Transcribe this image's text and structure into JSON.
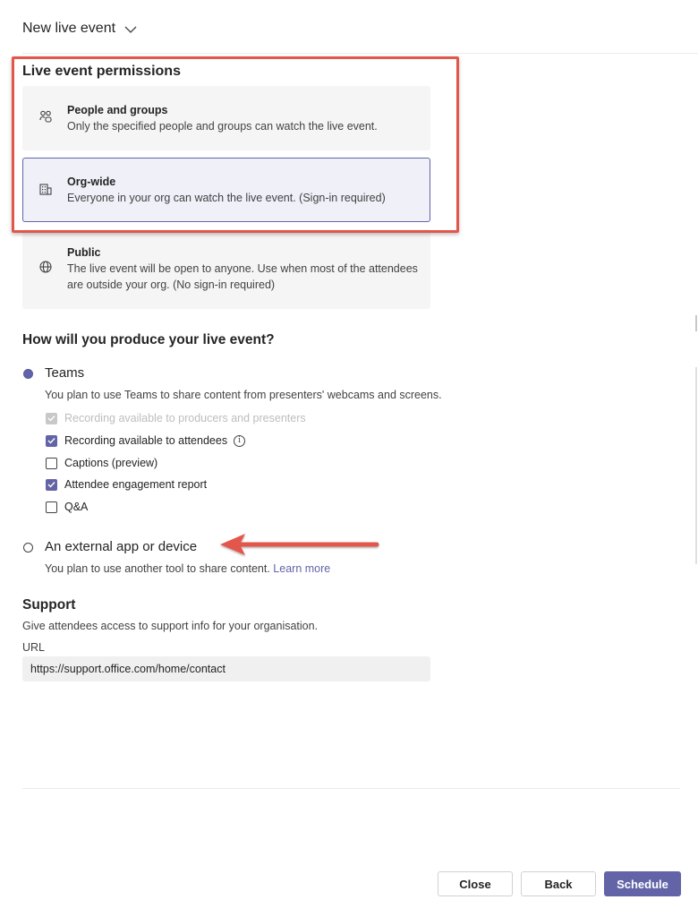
{
  "header": {
    "title": "New live event"
  },
  "permissions": {
    "title": "Live event permissions",
    "options": [
      {
        "title": "People and groups",
        "desc": "Only the specified people and groups can watch the live event.",
        "icon": "people-icon"
      },
      {
        "title": "Org-wide",
        "desc": "Everyone in your org can watch the live event. (Sign-in required)",
        "icon": "building-icon",
        "selected": true
      },
      {
        "title": "Public",
        "desc_line1": "The live event will be open to anyone. Use when most of the attendees",
        "desc_line2": "are outside your org. (No sign-in required)",
        "icon": "globe-icon"
      }
    ]
  },
  "produce": {
    "title": "How will you produce your live event?",
    "teams": {
      "label": "Teams",
      "desc": "You plan to use Teams to share content from presenters' webcams and screens.",
      "selected": true,
      "checks": [
        {
          "label": "Recording available to producers and presenters",
          "state": "checked-disabled"
        },
        {
          "label": "Recording available to attendees",
          "state": "checked"
        },
        {
          "label": "Captions (preview)",
          "state": "unchecked"
        },
        {
          "label": "Attendee engagement report",
          "state": "checked"
        },
        {
          "label": "Q&A",
          "state": "unchecked"
        }
      ]
    },
    "external": {
      "label": "An external app or device",
      "desc": "You plan to use another tool to share content.",
      "learn_more": "Learn more",
      "selected": false
    }
  },
  "support": {
    "title": "Support",
    "desc": "Give attendees access to support info for your organisation.",
    "url_label": "URL",
    "url_value": "https://support.office.com/home/contact"
  },
  "footer": {
    "close": "Close",
    "back": "Back",
    "schedule": "Schedule"
  },
  "colors": {
    "accent": "#6264a7",
    "annotation": "#e3574b"
  }
}
